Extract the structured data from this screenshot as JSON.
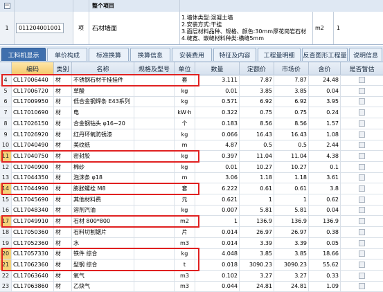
{
  "top_item": {
    "group_label": "整个项目",
    "row_number": "1",
    "code": "011204001001",
    "kind": "项",
    "name": "石材墙面",
    "features": [
      "1.墙体类型:混凝土墙",
      "2.安装方式:干挂",
      "3.面层材料品种、规格、颜色:30mm厚花岗岩石材",
      "4.缝宽、嵌缝材料种类:横缝5mm"
    ],
    "unit": "m2",
    "quantity": "1"
  },
  "tabs": [
    {
      "label": "工料机显示",
      "active": true
    },
    {
      "label": "单价构成",
      "active": false
    },
    {
      "label": "标准换算",
      "active": false
    },
    {
      "label": "换算信息",
      "active": false
    },
    {
      "label": "安装费用",
      "active": false
    },
    {
      "label": "特征及内容",
      "active": false
    },
    {
      "label": "工程量明细",
      "active": false
    },
    {
      "label": "反查图形工程量",
      "active": false
    },
    {
      "label": "说明信息",
      "active": false
    }
  ],
  "columns": [
    "编码",
    "类别",
    "名称",
    "规格及型号",
    "单位",
    "数量",
    "定额价",
    "市场价",
    "含价",
    "是否暂估"
  ],
  "rows": [
    {
      "n": "4",
      "code": "CL17006440",
      "cat": "材",
      "name": "不锈钢石材干挂挂件",
      "spec": "",
      "unit": "套",
      "qty": "3.111",
      "quota": "7.87",
      "market": "7.87",
      "total": "24.48"
    },
    {
      "n": "5",
      "code": "CL17006720",
      "cat": "材",
      "name": "草酸",
      "spec": "",
      "unit": "kg",
      "qty": "0.01",
      "quota": "3.85",
      "market": "3.85",
      "total": "0.04"
    },
    {
      "n": "6",
      "code": "CL17009950",
      "cat": "材",
      "name": "低合金钢焊条 E43系列",
      "spec": "",
      "unit": "kg",
      "qty": "0.571",
      "quota": "6.92",
      "market": "6.92",
      "total": "3.95"
    },
    {
      "n": "7",
      "code": "CL17010690",
      "cat": "材",
      "name": "电",
      "spec": "",
      "unit": "kW·h",
      "qty": "0.322",
      "quota": "0.75",
      "market": "0.75",
      "total": "0.24"
    },
    {
      "n": "8",
      "code": "CL17026150",
      "cat": "材",
      "name": "合金钢钻头 φ16~20",
      "spec": "",
      "unit": "个",
      "qty": "0.183",
      "quota": "8.56",
      "market": "8.56",
      "total": "1.57"
    },
    {
      "n": "9",
      "code": "CL17026920",
      "cat": "材",
      "name": "红丹环氧防锈漆",
      "spec": "",
      "unit": "kg",
      "qty": "0.066",
      "quota": "16.43",
      "market": "16.43",
      "total": "1.08"
    },
    {
      "n": "10",
      "code": "CL17040490",
      "cat": "材",
      "name": "美纹纸",
      "spec": "",
      "unit": "m",
      "qty": "4.87",
      "quota": "0.5",
      "market": "0.5",
      "total": "2.44"
    },
    {
      "n": "11",
      "code": "CL17040750",
      "cat": "材",
      "name": "密封胶",
      "spec": "",
      "unit": "kg",
      "qty": "0.397",
      "quota": "11.04",
      "market": "11.04",
      "total": "4.38"
    },
    {
      "n": "12",
      "code": "CL17040900",
      "cat": "材",
      "name": "棉纱",
      "spec": "",
      "unit": "kg",
      "qty": "0.01",
      "quota": "10.27",
      "market": "10.27",
      "total": "0.1"
    },
    {
      "n": "13",
      "code": "CL17044350",
      "cat": "材",
      "name": "泡沫条 φ18",
      "spec": "",
      "unit": "m",
      "qty": "3.06",
      "quota": "1.18",
      "market": "1.18",
      "total": "3.61"
    },
    {
      "n": "14",
      "code": "CL17044990",
      "cat": "材",
      "name": "膨胀螺栓 M8",
      "spec": "",
      "unit": "套",
      "qty": "6.222",
      "quota": "0.61",
      "market": "0.61",
      "total": "3.8"
    },
    {
      "n": "15",
      "code": "CL17045690",
      "cat": "材",
      "name": "其他材料费",
      "spec": "",
      "unit": "元",
      "qty": "0.621",
      "quota": "1",
      "market": "1",
      "total": "0.62"
    },
    {
      "n": "16",
      "code": "CL17048340",
      "cat": "材",
      "name": "溶剂汽油",
      "spec": "",
      "unit": "kg",
      "qty": "0.007",
      "quota": "5.81",
      "market": "5.81",
      "total": "0.04"
    },
    {
      "n": "17",
      "code": "CL17049910",
      "cat": "材",
      "name": "石材 800*800",
      "spec": "",
      "unit": "m2",
      "qty": "1",
      "quota": "136.9",
      "market": "136.9",
      "total": "136.9"
    },
    {
      "n": "18",
      "code": "CL17050360",
      "cat": "材",
      "name": "石料切割锯片",
      "spec": "",
      "unit": "片",
      "qty": "0.014",
      "quota": "26.97",
      "market": "26.97",
      "total": "0.38"
    },
    {
      "n": "19",
      "code": "CL17052360",
      "cat": "材",
      "name": "水",
      "spec": "",
      "unit": "m3",
      "qty": "0.014",
      "quota": "3.39",
      "market": "3.39",
      "total": "0.05"
    },
    {
      "n": "20",
      "code": "CL17057330",
      "cat": "材",
      "name": "铁件 综合",
      "spec": "",
      "unit": "kg",
      "qty": "4.048",
      "quota": "3.85",
      "market": "3.85",
      "total": "18.66"
    },
    {
      "n": "21",
      "code": "CL17062360",
      "cat": "材",
      "name": "型钢 综合",
      "spec": "",
      "unit": "t",
      "qty": "0.018",
      "quota": "3090.23",
      "market": "3090.23",
      "total": "55.62"
    },
    {
      "n": "22",
      "code": "CL17063640",
      "cat": "材",
      "name": "氧气",
      "spec": "",
      "unit": "m3",
      "qty": "0.102",
      "quota": "3.27",
      "market": "3.27",
      "total": "0.33"
    },
    {
      "n": "23",
      "code": "CL17063860",
      "cat": "材",
      "name": "乙炔气",
      "spec": "",
      "unit": "m3",
      "qty": "0.044",
      "quota": "24.81",
      "market": "24.81",
      "total": "1.09"
    }
  ],
  "selected_rows": [
    "11",
    "14",
    "17",
    "20",
    "21"
  ],
  "highlight_color": "#e02020"
}
